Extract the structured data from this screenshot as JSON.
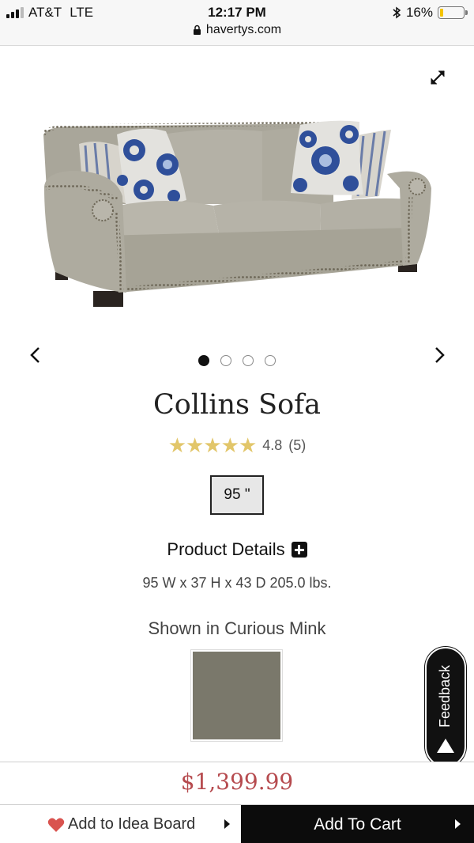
{
  "status_bar": {
    "carrier": "AT&T",
    "network": "LTE",
    "time": "12:17 PM",
    "battery": "16%",
    "battery_level": 0.16,
    "url": "havertys.com"
  },
  "gallery": {
    "slide_count": 4,
    "active_slide": 1
  },
  "product": {
    "title": "Collins Sofa",
    "rating_value": "4.8",
    "review_count": "(5)",
    "stars": "★★★★★",
    "size_option": "95 \"",
    "details_label": "Product Details",
    "dimensions": "95 W x 37 H x 43 D 205.0 lbs.",
    "shown_in": "Shown in Curious Mink",
    "swatch_color": "#7a786b",
    "price": "$1,399.99"
  },
  "feedback": {
    "label": "Feedback"
  },
  "actions": {
    "idea_board": "Add to Idea Board",
    "add_to_cart": "Add To Cart"
  },
  "colors": {
    "price": "#b64b4f",
    "star": "#e2c66a",
    "heart": "#d9534f",
    "cart_bg": "#0c0c0c"
  }
}
